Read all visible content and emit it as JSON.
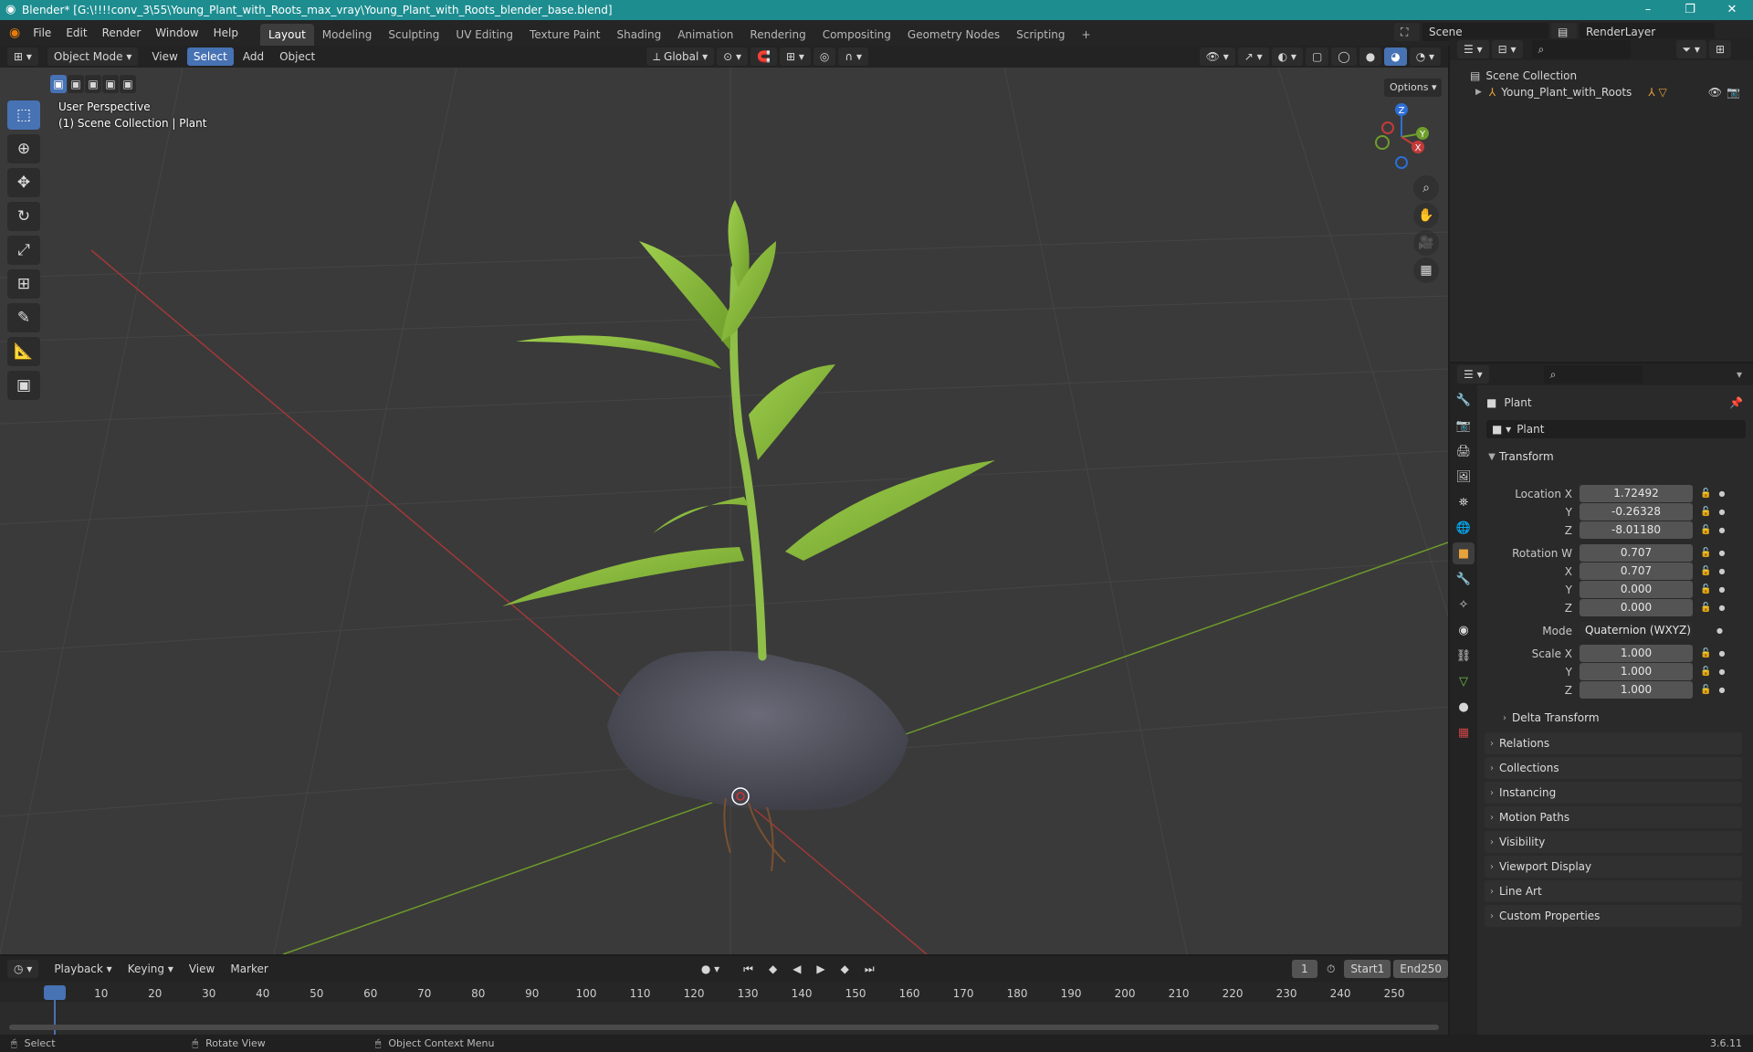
{
  "window": {
    "title": "Blender* [G:\\!!!!conv_3\\55\\Young_Plant_with_Roots_max_vray\\Young_Plant_with_Roots_blender_base.blend]",
    "minimize": "–",
    "maximize": "❐",
    "close": "✕"
  },
  "menu": {
    "items": [
      "File",
      "Edit",
      "Render",
      "Window",
      "Help"
    ]
  },
  "workspaces": [
    {
      "label": "Layout",
      "active": true
    },
    {
      "label": "Modeling"
    },
    {
      "label": "Sculpting"
    },
    {
      "label": "UV Editing"
    },
    {
      "label": "Texture Paint"
    },
    {
      "label": "Shading"
    },
    {
      "label": "Animation"
    },
    {
      "label": "Rendering"
    },
    {
      "label": "Compositing"
    },
    {
      "label": "Geometry Nodes"
    },
    {
      "label": "Scripting"
    }
  ],
  "add_workspace": "+",
  "scene": {
    "name": "Scene",
    "view_layer": "RenderLayer"
  },
  "viewport_header": {
    "mode": "Object Mode",
    "view": "View",
    "select": "Select",
    "add": "Add",
    "object": "Object",
    "orientation": "Global",
    "options": "Options"
  },
  "viewport_overlay": {
    "perspective": "User Perspective",
    "collection": "(1) Scene Collection | Plant"
  },
  "gizmo": {
    "z": "Z",
    "y": "Y",
    "x": "X"
  },
  "outliner": {
    "root": "Scene Collection",
    "item": "Young_Plant_with_Roots"
  },
  "properties": {
    "object_name": "Plant",
    "data_name": "Plant",
    "transform_title": "Transform",
    "location": {
      "label_x": "Location X",
      "x": "1.72492",
      "label_y": "Y",
      "y": "-0.26328",
      "label_z": "Z",
      "z": "-8.01180"
    },
    "rotation": {
      "label_w": "Rotation W",
      "w": "0.707",
      "label_x": "X",
      "x": "0.707",
      "label_y": "Y",
      "y": "0.000",
      "label_z": "Z",
      "z": "0.000"
    },
    "mode": {
      "label": "Mode",
      "value": "Quaternion (WXYZ)"
    },
    "scale": {
      "label_x": "Scale X",
      "x": "1.000",
      "label_y": "Y",
      "y": "1.000",
      "label_z": "Z",
      "z": "1.000"
    },
    "delta_transform": "Delta Transform",
    "sections": [
      "Relations",
      "Collections",
      "Instancing",
      "Motion Paths",
      "Visibility",
      "Viewport Display",
      "Line Art",
      "Custom Properties"
    ]
  },
  "timeline": {
    "playback": "Playback",
    "keying": "Keying",
    "view": "View",
    "marker": "Marker",
    "current_frame": "1",
    "start_label": "Start",
    "start": "1",
    "end_label": "End",
    "end": "250",
    "ticks": [
      "1",
      "10",
      "20",
      "30",
      "40",
      "50",
      "60",
      "70",
      "80",
      "90",
      "100",
      "110",
      "120",
      "130",
      "140",
      "150",
      "160",
      "170",
      "180",
      "190",
      "200",
      "210",
      "220",
      "230",
      "240",
      "250"
    ]
  },
  "statusbar": {
    "select": "Select",
    "rotate": "Rotate View",
    "context": "Object Context Menu",
    "version": "3.6.11"
  },
  "colors": {
    "accent": "#4772b3",
    "titlebar": "#1d8d90",
    "x_axis": "#a13838",
    "y_axis": "#6d9a2a"
  }
}
